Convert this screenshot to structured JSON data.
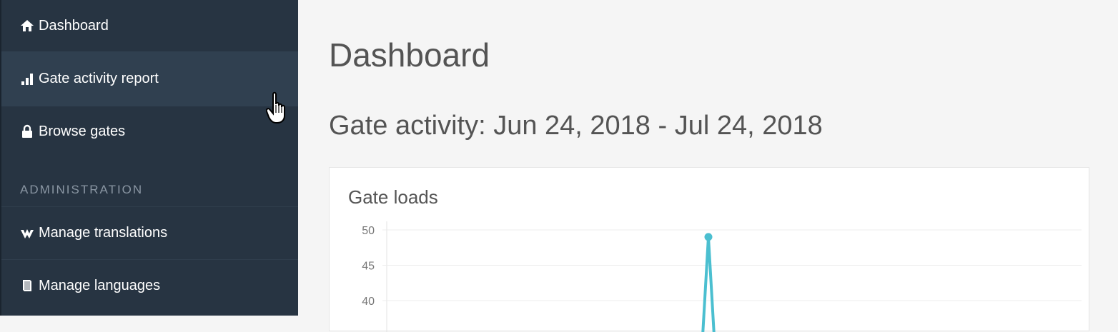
{
  "sidebar": {
    "items": [
      {
        "label": "Dashboard",
        "icon": "home-icon"
      },
      {
        "label": "Gate activity report",
        "icon": "bar-chart-icon"
      },
      {
        "label": "Browse gates",
        "icon": "lock-icon"
      }
    ],
    "section_label": "ADMINISTRATION",
    "admin_items": [
      {
        "label": "Manage translations",
        "icon": "translate-icon"
      },
      {
        "label": "Manage languages",
        "icon": "book-icon"
      }
    ]
  },
  "main": {
    "title": "Dashboard",
    "subtitle": "Gate activity: Jun 24, 2018 - Jul 24, 2018",
    "card_title": "Gate loads"
  },
  "colors": {
    "sidebar_bg": "#273442",
    "sidebar_active": "#304050",
    "line": "#4bbfd0"
  },
  "chart_data": {
    "type": "line",
    "title": "Gate loads",
    "xlabel": "",
    "ylabel": "",
    "ylim_visible": [
      40,
      50
    ],
    "y_ticks": [
      50,
      45,
      40
    ],
    "grid": true,
    "series": [
      {
        "points": [
          {
            "x_frac": 0.5,
            "y": 49
          }
        ]
      }
    ]
  }
}
